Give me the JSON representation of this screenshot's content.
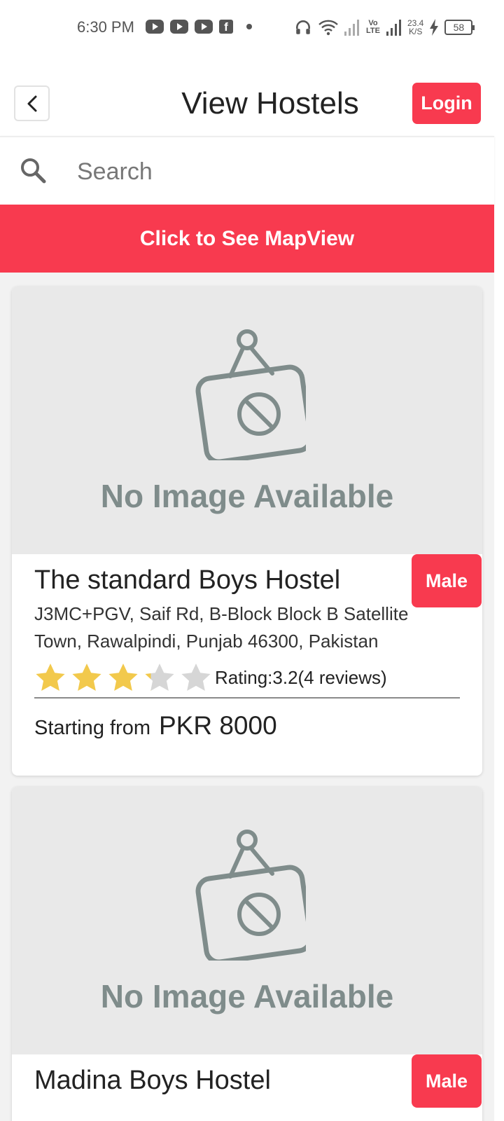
{
  "status": {
    "time": "6:30 PM",
    "volte": "Vo LTE",
    "speed_value": "23.4",
    "speed_unit": "K/S",
    "battery": "58"
  },
  "header": {
    "title": "View Hostels",
    "login_label": "Login"
  },
  "search": {
    "placeholder": "Search"
  },
  "map_button_label": "Click to See MapView",
  "hostels": [
    {
      "no_image_text": "No Image Available",
      "name": "The standard Boys Hostel",
      "gender": "Male",
      "address": "J3MC+PGV, Saif Rd, B-Block Block B Satellite Town, Rawalpindi, Punjab 46300, Pakistan",
      "rating": 3.2,
      "rating_text": "Rating:3.2(4 reviews)",
      "price_prefix": "Starting from",
      "price": "PKR 8000"
    },
    {
      "no_image_text": "No Image Available",
      "name": "Madina Boys Hostel",
      "gender": "Male"
    }
  ],
  "colors": {
    "accent": "#f83a4f",
    "star_filled": "#f2c94c",
    "star_empty": "#d6d6d6",
    "placeholder_icon": "#7f8c8b"
  }
}
